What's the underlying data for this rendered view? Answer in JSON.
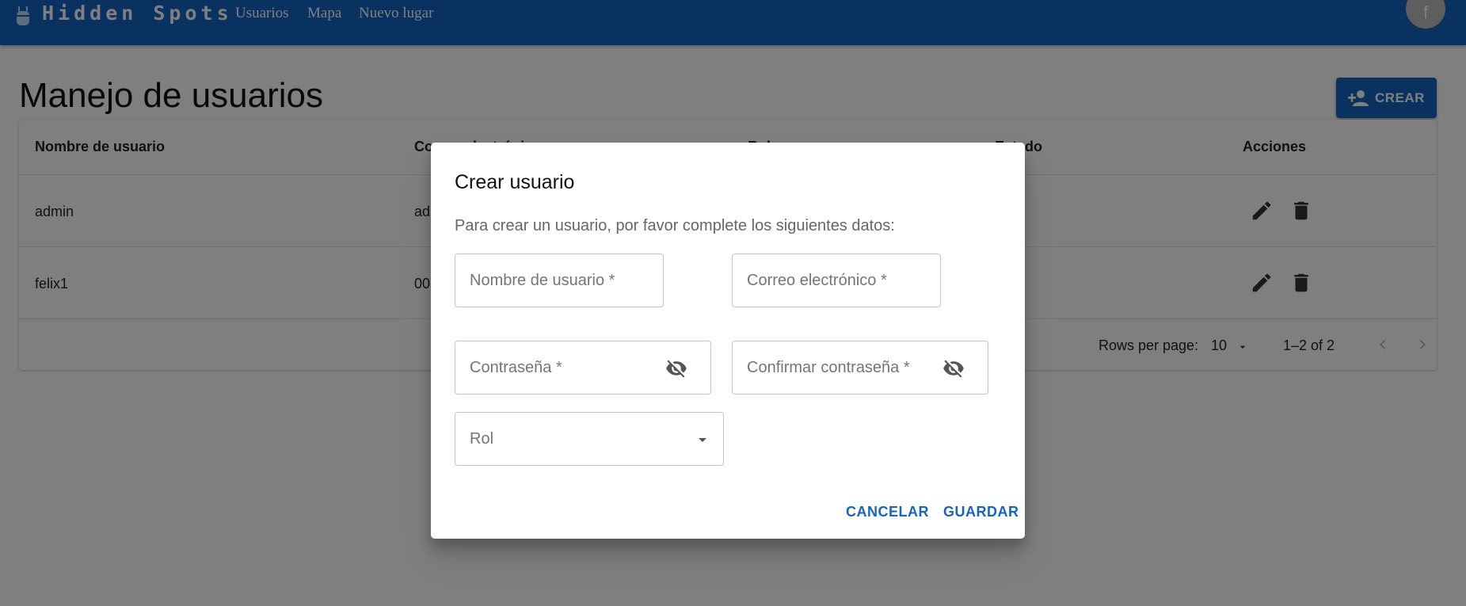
{
  "app": {
    "brand": "Hidden Spots",
    "nav": [
      "Usuarios",
      "Mapa",
      "Nuevo lugar"
    ],
    "avatar_letter": "f"
  },
  "page": {
    "title": "Manejo de usuarios",
    "create_button": "CREAR"
  },
  "table": {
    "columns": [
      "Nombre de usuario",
      "Correo electrónico",
      "Rol",
      "Estado",
      "Acciones"
    ],
    "rows": [
      {
        "username": "admin",
        "email": "ad"
      },
      {
        "username": "felix1",
        "email": "00"
      }
    ],
    "rows_per_page_label": "Rows per page:",
    "rows_per_page_value": "10",
    "pagination": "1–2 of 2"
  },
  "dialog": {
    "title": "Crear usuario",
    "text": "Para crear un usuario, por favor complete los siguientes datos:",
    "fields": {
      "username": "Nombre de usuario *",
      "email": "Correo electrónico *",
      "password": "Contraseña *",
      "confirm_password": "Confirmar contraseña *",
      "role": "Rol"
    },
    "cancel": "CANCELAR",
    "save": "GUARDAR"
  },
  "colors": {
    "primary": "#1565c0",
    "overlay": "rgba(0,0,0,0.5)"
  }
}
